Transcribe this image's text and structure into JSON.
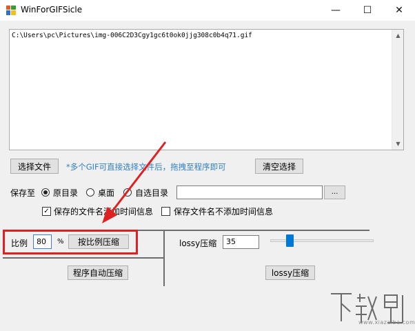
{
  "window": {
    "title": "WinForGIFSicle",
    "minimize_glyph": "—",
    "maximize_glyph": "☐",
    "close_glyph": "✕"
  },
  "file_list": {
    "items": [
      "C:\\Users\\pc\\Pictures\\img-006C2D3Cgy1gc6t0ok0jjg308c0b4q71.gif"
    ],
    "scroll_up_glyph": "▲",
    "scroll_down_glyph": "▼"
  },
  "select_file_button": "选择文件",
  "hint_text": "*多个GIF可直接选择文件后，拖拽至程序即可",
  "clear_selection_button": "清空选择",
  "save_to": {
    "label": "保存至",
    "options": [
      "原目录",
      "桌面",
      "自选目录"
    ],
    "selected": "原目录",
    "custom_path_value": "",
    "browse_button": "..."
  },
  "checkboxes": {
    "add_time_label": "保存的文件名添加时间信息",
    "add_time_checked": true,
    "no_time_label": "保存文件名不添加时间信息",
    "no_time_checked": false
  },
  "ratio": {
    "label": "比例",
    "value": "80",
    "unit": "%",
    "compress_button": "按比例压缩"
  },
  "auto_compress_button": "程序自动压缩",
  "lossy": {
    "label": "lossy压缩",
    "value": "35",
    "slider_value": 35,
    "slider_max": 200,
    "compress_button": "lossy压缩"
  },
  "annotation": {
    "highlight_color": "#e02020"
  },
  "watermark": {
    "logo_text": "下载吧",
    "url": "www.xiazaiba.com"
  }
}
